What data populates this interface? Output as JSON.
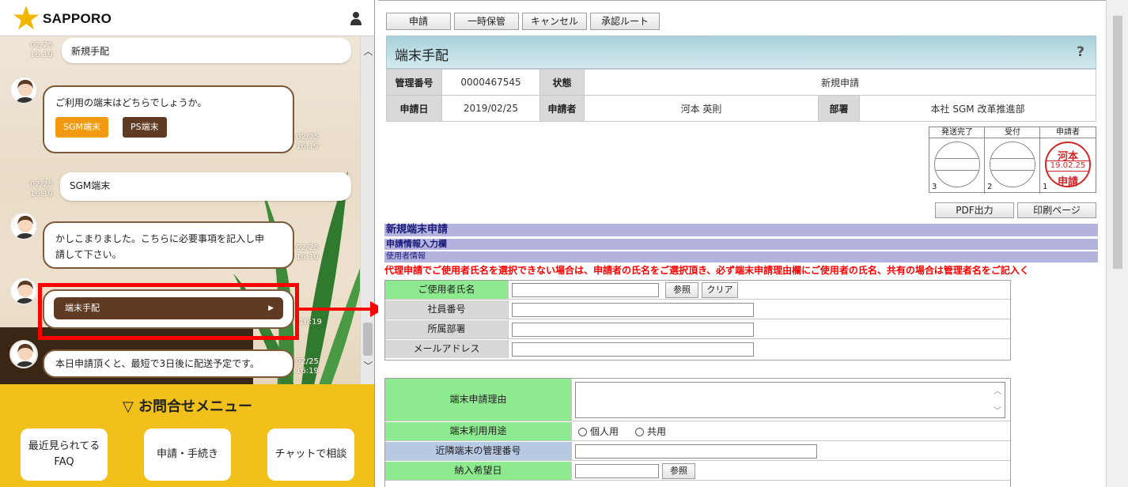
{
  "chat": {
    "logo_text": "SAPPORO",
    "messages": [
      {
        "time_date": "02/25",
        "time_clock": "16:19",
        "text": "新規手配"
      },
      {
        "text": "ご利用の端末はどちらでしょうか。",
        "time_date": "02/25",
        "time_clock": "16:19"
      },
      {
        "time_date": "02/25",
        "time_clock": "16:19",
        "text": "SGM端末"
      },
      {
        "text_line1": "かしこまりました。こちらに必要事項を記入し申",
        "text_line2": "請して下さい。",
        "time_date": "02/25",
        "time_clock": "16:19"
      },
      {
        "button_label": "端末手配",
        "time_clock": "16:19"
      },
      {
        "text": "本日申請頂くと、最短で3日後に配送予定です。",
        "time_date": "02/25",
        "time_clock": "16:19"
      }
    ],
    "options": {
      "sgm": "SGM端末",
      "ps": "PS端末"
    },
    "footer": {
      "title": "▽ お問合せメニュー",
      "btn_faq_line1": "最近見られてる",
      "btn_faq_line2": "FAQ",
      "btn_apply": "申請・手続き",
      "btn_chat": "チャットで相談"
    },
    "colors": {
      "accent": "#f2c01a",
      "brown": "#5e3b22",
      "orange": "#f29b12",
      "highlight": "#ff0000"
    }
  },
  "form": {
    "toolbar": {
      "apply": "申請",
      "hold": "一時保管",
      "cancel": "キャンセル",
      "route": "承認ルート"
    },
    "title": "端末手配",
    "help": "?",
    "info": {
      "mgmt_label": "管理番号",
      "mgmt_value": "0000467545",
      "status_label": "状態",
      "status_value": "新規申請",
      "date_label": "申請日",
      "date_value": "2019/02/25",
      "applicant_label": "申請者",
      "applicant_value": "河本 英則",
      "dept_label": "部署",
      "dept_value": "本社 SGM 改革推進部"
    },
    "stamps": {
      "col1": {
        "head": "発送完了",
        "num": "3"
      },
      "col2": {
        "head": "受付",
        "num": "2"
      },
      "col3": {
        "head": "申請者",
        "num": "1",
        "name": "河本",
        "date": "19.02.25",
        "status": "申請"
      }
    },
    "pdf": "PDF出力",
    "print": "印刷ページ",
    "section_title": "新規端末申請",
    "section_sub": "申請情報入力欄",
    "section_user": "使用者情報",
    "warning": "代理申請でご使用者氏名を選択できない場合は、申請者の氏名をご選択頂き、必ず端末申請理由欄にご使用者の氏名、共有の場合は管理者名をご記入く",
    "user_fields": {
      "name": "ご使用者氏名",
      "ref": "参照",
      "clear": "クリア",
      "emp_no": "社員番号",
      "dept": "所属部署",
      "mail": "メールアドレス"
    },
    "device_fields": {
      "reason": "端末申請理由",
      "usage": "端末利用用途",
      "usage_personal": "個人用",
      "usage_shared": "共用",
      "nearby": "近隣端末の管理番号",
      "delivery": "納入希望日",
      "ref": "参照"
    }
  }
}
